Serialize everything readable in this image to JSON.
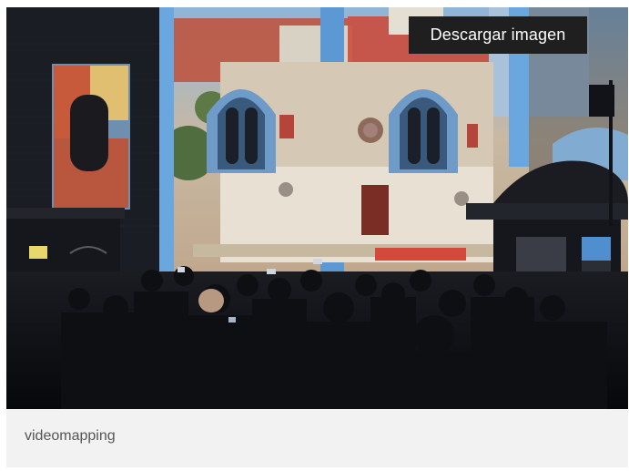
{
  "image": {
    "alt": "videomapping",
    "download_label": "Descargar imagen",
    "caption": "videomapping"
  },
  "colors": {
    "card_background": "#f2f2f2",
    "button_background": "#1f1f1f",
    "button_text": "#ffffff",
    "caption_text": "#555555"
  },
  "icons": []
}
